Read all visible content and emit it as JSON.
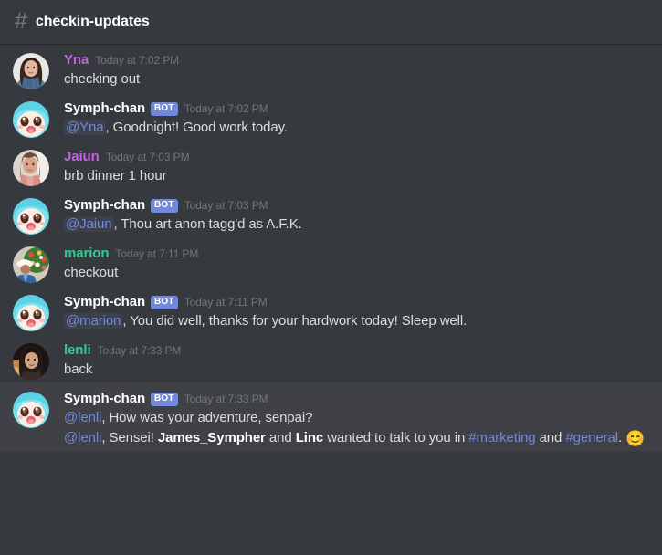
{
  "header": {
    "hash_icon": "#",
    "channel_name": "checkin-updates"
  },
  "colors": {
    "background": "#36393e",
    "highlight_background": "#3f4146",
    "bot_badge": "#7289da",
    "mention": "#7289da",
    "name_purple": "#c264e0",
    "name_green": "#2ecc8f",
    "name_white": "#ffffff",
    "timestamp": "#72767d",
    "text": "#dcddde"
  },
  "messages": [
    {
      "author": "Yna",
      "author_color": "#c264e0",
      "bot": false,
      "bot_label": "",
      "timestamp": "Today at 7:02 PM",
      "avatar": "avatar-yna",
      "highlight": false,
      "lines": [
        {
          "segments": [
            {
              "type": "text",
              "text": "checking out"
            }
          ]
        }
      ]
    },
    {
      "author": "Symph-chan",
      "author_color": "#ffffff",
      "bot": true,
      "bot_label": "BOT",
      "timestamp": "Today at 7:02 PM",
      "avatar": "avatar-symph-chan",
      "highlight": false,
      "lines": [
        {
          "segments": [
            {
              "type": "mention",
              "text": "@Yna"
            },
            {
              "type": "text",
              "text": ", Goodnight! Good work today."
            }
          ]
        }
      ]
    },
    {
      "author": "Jaiun",
      "author_color": "#c264e0",
      "bot": false,
      "bot_label": "",
      "timestamp": "Today at 7:03 PM",
      "avatar": "avatar-jaiun",
      "highlight": false,
      "lines": [
        {
          "segments": [
            {
              "type": "text",
              "text": "brb dinner 1 hour"
            }
          ]
        }
      ]
    },
    {
      "author": "Symph-chan",
      "author_color": "#ffffff",
      "bot": true,
      "bot_label": "BOT",
      "timestamp": "Today at 7:03 PM",
      "avatar": "avatar-symph-chan",
      "highlight": false,
      "lines": [
        {
          "segments": [
            {
              "type": "mention",
              "text": "@Jaiun"
            },
            {
              "type": "text",
              "text": ", Thou art anon tagg'd as A.F.K."
            }
          ]
        }
      ]
    },
    {
      "author": "marion",
      "author_color": "#2ecc8f",
      "bot": false,
      "bot_label": "",
      "timestamp": "Today at 7:11 PM",
      "avatar": "avatar-marion",
      "highlight": false,
      "lines": [
        {
          "segments": [
            {
              "type": "text",
              "text": "checkout"
            }
          ]
        }
      ]
    },
    {
      "author": "Symph-chan",
      "author_color": "#ffffff",
      "bot": true,
      "bot_label": "BOT",
      "timestamp": "Today at 7:11 PM",
      "avatar": "avatar-symph-chan",
      "highlight": false,
      "lines": [
        {
          "segments": [
            {
              "type": "mention",
              "text": "@marion"
            },
            {
              "type": "text",
              "text": ", You did well, thanks for your hardwork today! Sleep well."
            }
          ]
        }
      ]
    },
    {
      "author": "lenli",
      "author_color": "#2ecc8f",
      "bot": false,
      "bot_label": "",
      "timestamp": "Today at 7:33 PM",
      "avatar": "avatar-lenli",
      "highlight": false,
      "lines": [
        {
          "segments": [
            {
              "type": "text",
              "text": "back"
            }
          ]
        }
      ]
    },
    {
      "author": "Symph-chan",
      "author_color": "#ffffff",
      "bot": true,
      "bot_label": "BOT",
      "timestamp": "Today at 7:33 PM",
      "avatar": "avatar-symph-chan",
      "highlight": true,
      "lines": [
        {
          "segments": [
            {
              "type": "mention-plain",
              "text": "@lenli"
            },
            {
              "type": "text",
              "text": ", How was your adventure, senpai?"
            }
          ]
        },
        {
          "segments": [
            {
              "type": "mention-plain",
              "text": "@lenli"
            },
            {
              "type": "text",
              "text": ", Sensei! "
            },
            {
              "type": "bold",
              "text": "James_Sympher"
            },
            {
              "type": "text",
              "text": " and "
            },
            {
              "type": "bold",
              "text": "Linc"
            },
            {
              "type": "text",
              "text": " wanted to talk to you in "
            },
            {
              "type": "channel",
              "text": "#marketing"
            },
            {
              "type": "text",
              "text": " and "
            },
            {
              "type": "channel",
              "text": "#general"
            },
            {
              "type": "text",
              "text": ". "
            },
            {
              "type": "emoji",
              "text": "😊"
            }
          ]
        }
      ]
    }
  ]
}
